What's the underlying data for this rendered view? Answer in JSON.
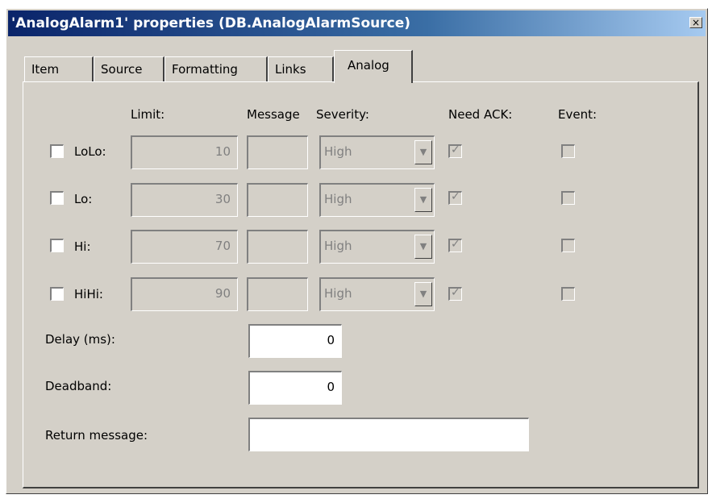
{
  "window": {
    "title": "'AnalogAlarm1' properties (DB.AnalogAlarmSource)",
    "close_label": "×"
  },
  "tabs": [
    {
      "label": "Item"
    },
    {
      "label": "Source"
    },
    {
      "label": "Formatting"
    },
    {
      "label": "Links"
    },
    {
      "label": "Analog",
      "active": true
    }
  ],
  "headers": {
    "limit": "Limit:",
    "message": "Message",
    "severity": "Severity:",
    "need_ack": "Need ACK:",
    "event": "Event:"
  },
  "rows": [
    {
      "label": "LoLo:",
      "limit": "10",
      "message": "",
      "severity": "High",
      "enabled": false,
      "need_ack": true,
      "event": false
    },
    {
      "label": "Lo:",
      "limit": "30",
      "message": "",
      "severity": "High",
      "enabled": false,
      "need_ack": true,
      "event": false
    },
    {
      "label": "Hi:",
      "limit": "70",
      "message": "",
      "severity": "High",
      "enabled": false,
      "need_ack": true,
      "event": false
    },
    {
      "label": "HiHi:",
      "limit": "90",
      "message": "",
      "severity": "High",
      "enabled": false,
      "need_ack": true,
      "event": false
    }
  ],
  "delay": {
    "label": "Delay (ms):",
    "value": "0"
  },
  "deadband": {
    "label": "Deadband:",
    "value": "0"
  },
  "return_message": {
    "label": "Return message:",
    "value": ""
  },
  "icons": {
    "checkmark": "✓",
    "dropdown": "▼"
  },
  "colors": {
    "face": "#d4d0c8",
    "title_start": "#0a246a",
    "title_end": "#a6caf0",
    "disabled_text": "#808080"
  }
}
